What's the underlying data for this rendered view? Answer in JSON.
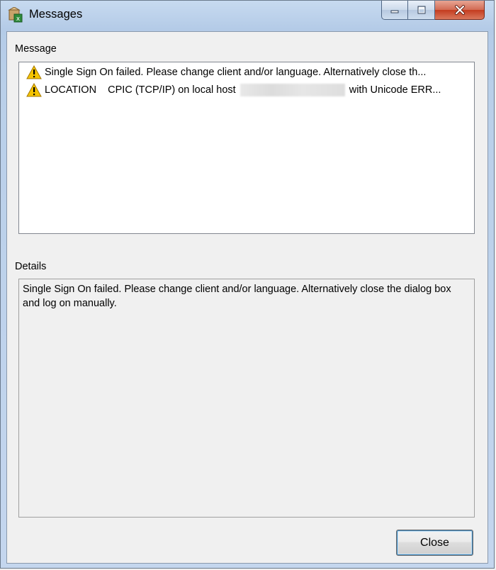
{
  "window": {
    "title": "Messages",
    "icon": "app-icon",
    "controls": [
      "minimize-icon",
      "maximize-icon",
      "close-icon"
    ]
  },
  "message_section": {
    "label": "Message",
    "rows": [
      {
        "icon": "warning-icon",
        "text": "Single Sign On failed. Please change client and/or language. Alternatively close th..."
      },
      {
        "icon": "warning-icon",
        "text_before": "LOCATION    CPIC (TCP/IP) on local host ",
        "text_after": " with Unicode ERR..."
      }
    ]
  },
  "details_section": {
    "label": "Details",
    "text": "Single Sign On failed. Please change client and/or language. Alternatively close the dialog box and log on manually."
  },
  "buttons": {
    "close_label": "Close"
  },
  "colors": {
    "frame": "#b9cfe9",
    "close_control": "#c43c1f",
    "warning": "#f5c400"
  }
}
